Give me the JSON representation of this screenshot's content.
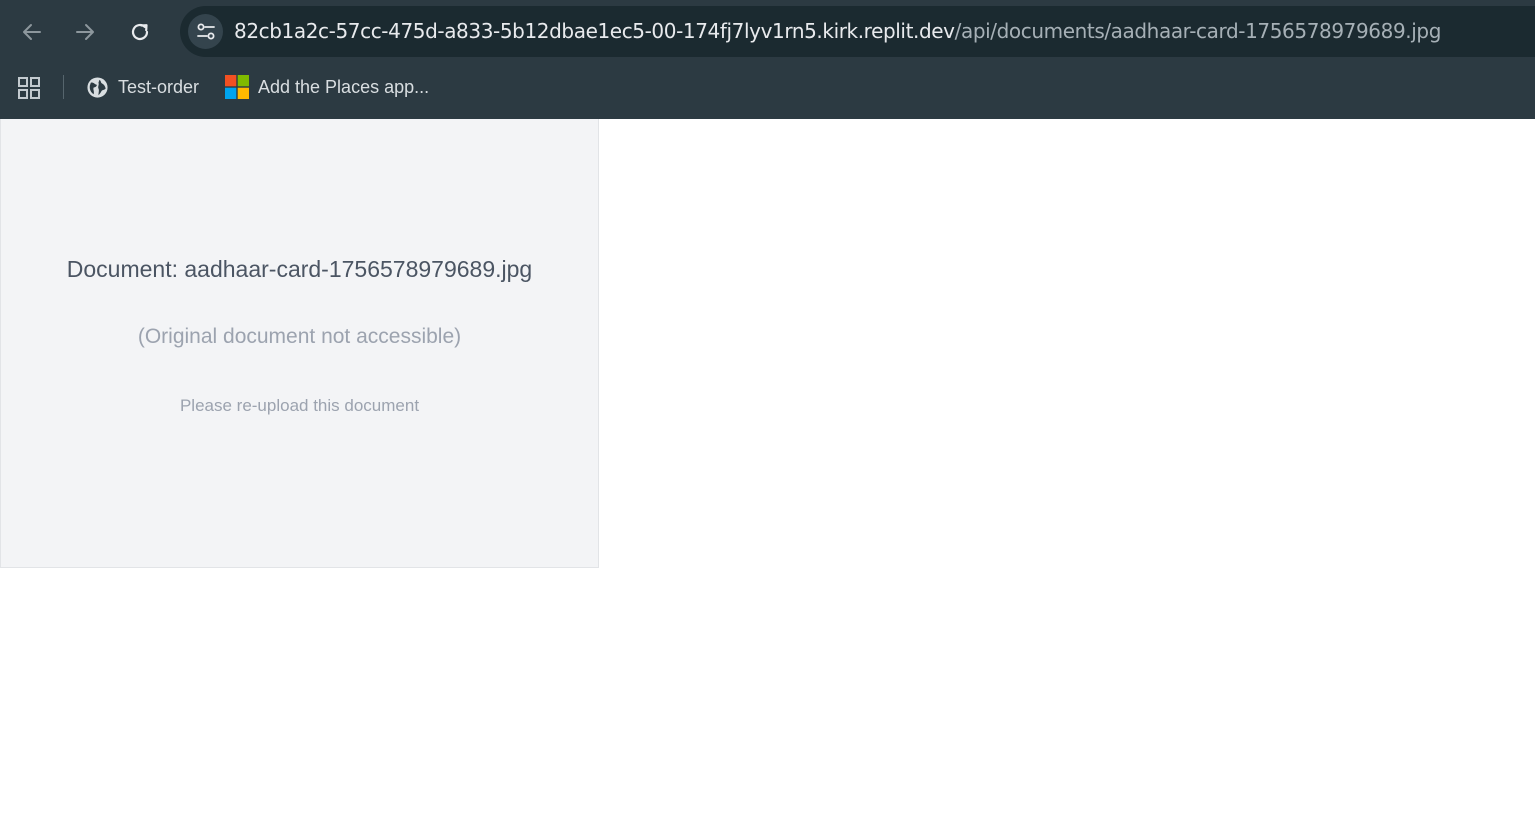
{
  "browser": {
    "url_host": "82cb1a2c-57cc-475d-a833-5b12dbae1ec5-00-174fj7lyv1rn5.kirk.replit.dev",
    "url_path": "/api/documents/aadhaar-card-1756578979689.jpg",
    "bookmarks": [
      {
        "label": "Test-order",
        "icon": "globe-icon"
      },
      {
        "label": "Add the Places app...",
        "icon": "microsoft-logo-icon"
      }
    ],
    "colors": {
      "toolbar": "#2c3a42",
      "omnibox": "#1b2a30"
    }
  },
  "document": {
    "title": "Document: aadhaar-card-1756578979689.jpg",
    "status": "(Original document not accessible)",
    "hint": "Please re-upload this document",
    "panel_color": "#f3f4f6"
  }
}
